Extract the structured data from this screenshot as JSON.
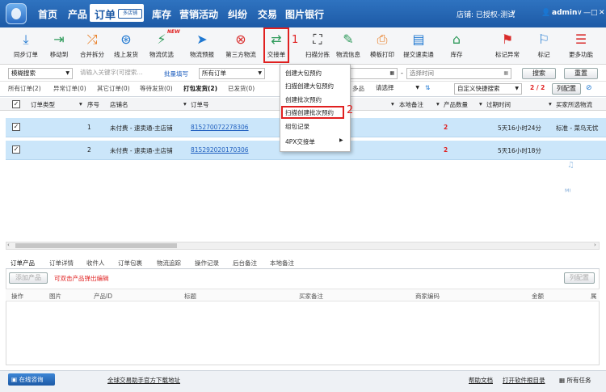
{
  "nav": [
    "首页",
    "产品",
    "订单",
    "库存",
    "营销活动",
    "纠纷",
    "交易",
    "图片银行"
  ],
  "nav_badge": "多店铺",
  "store_label": "店铺: 已授权-测试",
  "user": "admin",
  "window_controls": [
    "—",
    "□",
    "✕"
  ],
  "toolbar": [
    "同步订单",
    "移动到",
    "合并拆分",
    "线上发货",
    "物流优选",
    "物流预报",
    "第三方物流",
    "交接单",
    "扫描分拣",
    "物流信息",
    "模板打印",
    "提交速卖通",
    "库存",
    "标记异常",
    "标记",
    "更多功能"
  ],
  "new_badge": "NEW",
  "callouts": [
    "1",
    "2"
  ],
  "search": {
    "mode": "模糊搜索",
    "keyword_placeholder": "请输入关键字(可搜索...",
    "batch": "批量填写",
    "order_type": "所有订单",
    "platform": "多品",
    "select": "请选择",
    "start_placeholder": "",
    "end_placeholder": "选择时间",
    "search_btn": "搜索",
    "reset_btn": "重置"
  },
  "status_tabs": [
    "所有订单(2)",
    "异常订单(0)",
    "其它订单(0)",
    "等待发货(0)",
    "打包发货(2)",
    "已发货(0)"
  ],
  "quick_search": "自定义快捷搜索",
  "pager": "2 / 2",
  "col_config": "列配置",
  "headers": [
    "订单类型",
    "序号",
    "店铺名",
    "订单号",
    "本地备注",
    "产品数量",
    "过期时间",
    "买家所选物流"
  ],
  "rows": [
    {
      "seq": "1",
      "store": "未付费 - 速卖通-主店铺",
      "order": "815270072278306",
      "qty": "2",
      "expire": "5天16小时24分",
      "logistics": "标准 - 菜鸟无忧"
    },
    {
      "seq": "2",
      "store": "未付费 - 速卖通-主店铺",
      "order": "815292020170306",
      "qty": "2",
      "expire": "5天16小时18分",
      "logistics": ""
    }
  ],
  "dropdown_menu": [
    "创建大包预约",
    "扫描创建大包预约",
    "创建批次预约",
    "扫描创建批次预约",
    "组包记录",
    "4PX交接单"
  ],
  "bottom_tabs": [
    "订单产品",
    "订单详情",
    "收件人",
    "订单包裹",
    "物流追踪",
    "操作记录",
    "后台备注",
    "本地备注"
  ],
  "add_product": "添加产品",
  "hint": "可双击产品弹出编辑",
  "bottom_col_config": "列配置",
  "bottom_headers": [
    "操作",
    "图片",
    "产品ID",
    "标题",
    "买家备注",
    "商家编码",
    "金额",
    "属"
  ],
  "statusbar": {
    "online": "在线咨询",
    "download": "全球交易助手官方下载地址",
    "help": "帮助文档",
    "open_dir": "打开软件根目录",
    "tasks": "所有任务"
  },
  "colors": {
    "title_bar": "#1d5aa6",
    "selected_row": "#cbe6fa",
    "highlight": "#e02020"
  }
}
